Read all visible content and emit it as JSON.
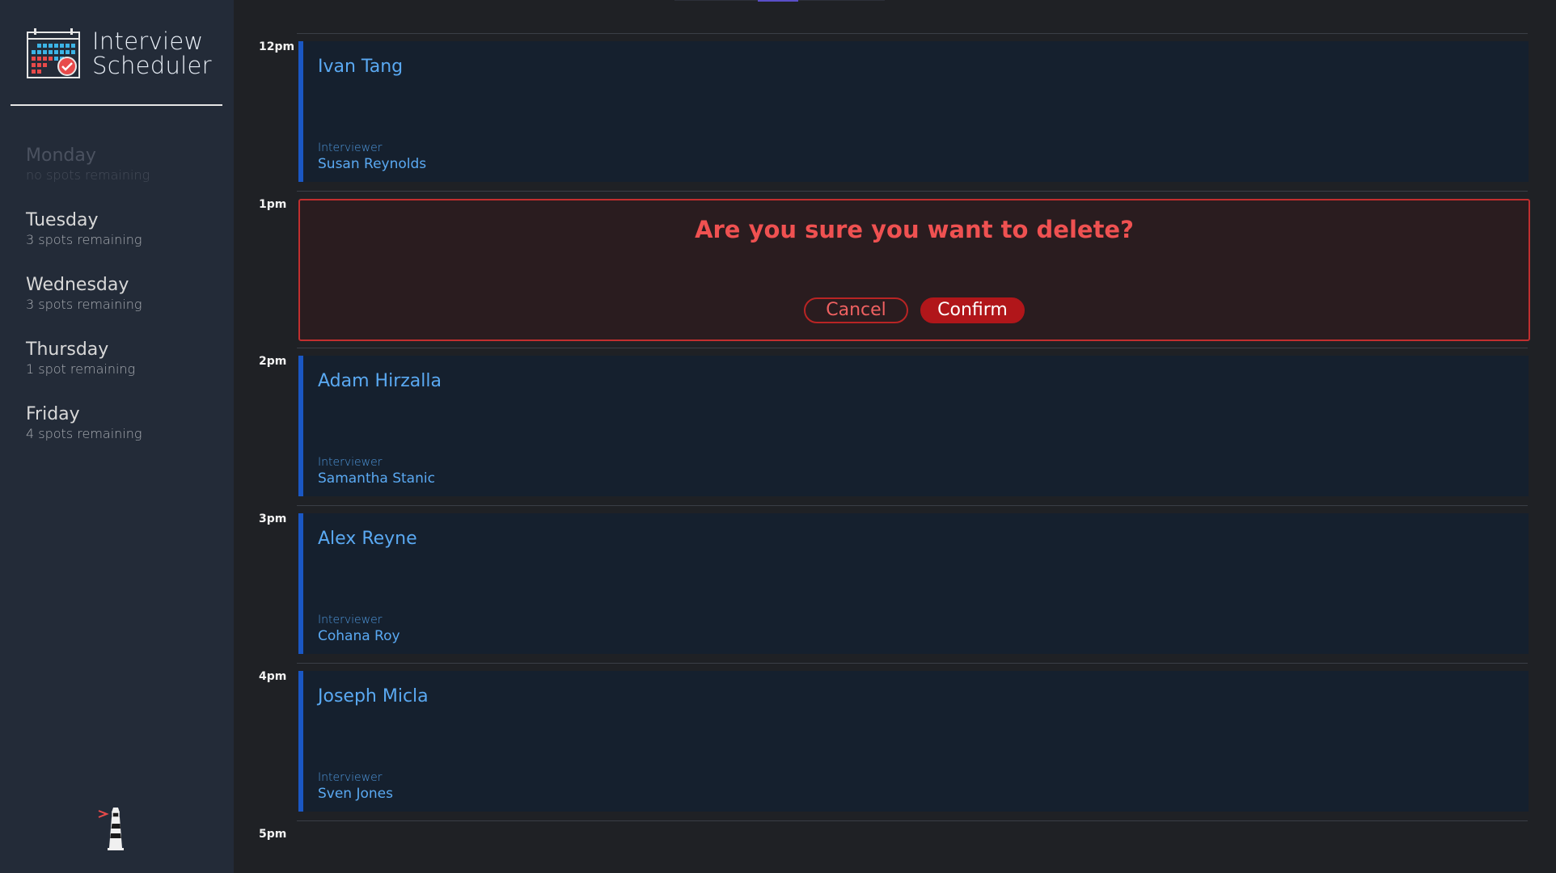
{
  "app": {
    "title_line1": "Interview",
    "title_line2": "Scheduler"
  },
  "sidebar": {
    "days": [
      {
        "name": "Monday",
        "spots": "no spots remaining",
        "full": true
      },
      {
        "name": "Tuesday",
        "spots": "3 spots remaining",
        "full": false
      },
      {
        "name": "Wednesday",
        "spots": "3 spots remaining",
        "full": false
      },
      {
        "name": "Thursday",
        "spots": "1 spot remaining",
        "full": false
      },
      {
        "name": "Friday",
        "spots": "4 spots remaining",
        "full": false
      }
    ]
  },
  "schedule": {
    "hours": [
      "12pm",
      "1pm",
      "2pm",
      "3pm",
      "4pm",
      "5pm"
    ],
    "interviewer_label": "Interviewer",
    "appointments": [
      {
        "student": "Ivan Tang",
        "interviewer": "Susan Reynolds"
      },
      {
        "student": "Adam Hirzalla",
        "interviewer": "Samantha Stanic"
      },
      {
        "student": "Alex Reyne",
        "interviewer": "Cohana Roy"
      },
      {
        "student": "Joseph Micla",
        "interviewer": "Sven Jones"
      }
    ],
    "confirm": {
      "message": "Are you sure you want to delete?",
      "cancel_label": "Cancel",
      "confirm_label": "Confirm"
    }
  },
  "colors": {
    "sidebar_bg": "#232b38",
    "main_bg": "#1f2125",
    "appointment_bg": "#15202e",
    "appointment_accent": "#1a57c4",
    "text_blue": "#5aa9f2",
    "danger": "#c12f2f",
    "danger_text": "#ef5151"
  },
  "icons": {
    "brand": "calendar-check-icon",
    "footer": "lighthouse-icon"
  }
}
